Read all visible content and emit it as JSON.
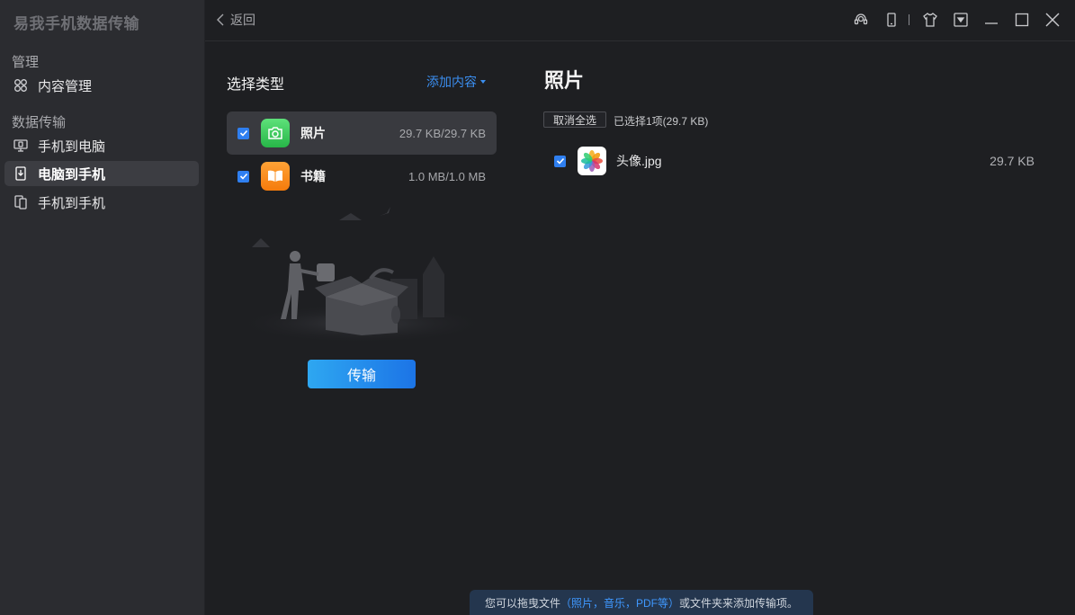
{
  "app": {
    "title": "易我手机数据传输"
  },
  "sidebar": {
    "sections": [
      {
        "title": "管理",
        "items": [
          {
            "label": "内容管理",
            "icon": "apps-icon"
          }
        ]
      },
      {
        "title": "数据传输",
        "items": [
          {
            "label": "手机到电脑",
            "icon": "phone-to-pc-icon"
          },
          {
            "label": "电脑到手机",
            "icon": "pc-to-phone-icon",
            "active": true
          },
          {
            "label": "手机到手机",
            "icon": "phone-to-phone-icon"
          }
        ]
      }
    ]
  },
  "topbar": {
    "back_label": "返回"
  },
  "types_panel": {
    "title": "选择类型",
    "add_content_label": "添加内容",
    "types": [
      {
        "name": "照片",
        "size": "29.7 KB/29.7 KB",
        "checked": true,
        "icon": "camera-icon",
        "active": true
      },
      {
        "name": "书籍",
        "size": "1.0 MB/1.0 MB",
        "checked": true,
        "icon": "book-icon"
      }
    ],
    "transfer_label": "传输"
  },
  "detail_panel": {
    "title": "照片",
    "deselect_label": "取消全选",
    "selected_info": "已选择1项(29.7 KB)",
    "files": [
      {
        "name": "头像.jpg",
        "size": "29.7 KB",
        "checked": true,
        "icon": "photos-app-icon"
      }
    ]
  },
  "hint": {
    "prefix": "您可以拖曳文件",
    "highlight": "（照片，音乐，PDF等）",
    "suffix": "或文件夹来添加传输项。"
  },
  "colors": {
    "accent": "#2f7ff0",
    "link": "#3b8ef0",
    "sidebar_bg": "#2b2c30",
    "main_bg": "#1e1f22"
  }
}
